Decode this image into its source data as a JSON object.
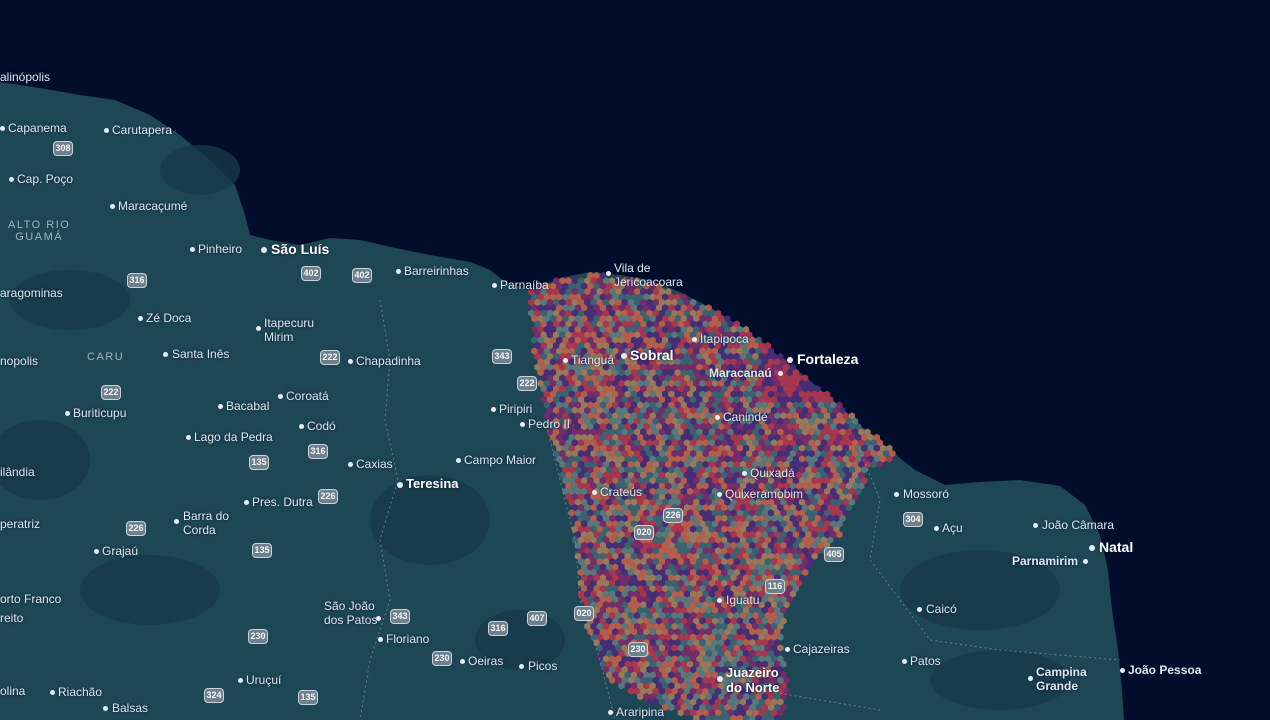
{
  "map": {
    "colors": {
      "ocean": "#020d2b",
      "land": "#1e4756",
      "land_dark": "#173a48",
      "hex_palette": [
        "#4a2a7a",
        "#7d2a6a",
        "#b8344f",
        "#c5604a",
        "#a77e5c",
        "#5f7d80",
        "#3d6675"
      ]
    },
    "places": [
      {
        "name": "alinópolis",
        "size": "small"
      },
      {
        "name": "Capanema",
        "size": "small"
      },
      {
        "name": "Carutapera",
        "size": "small"
      },
      {
        "name": "Cap. Poço",
        "size": "small"
      },
      {
        "name": "Maracaçumé",
        "size": "small"
      },
      {
        "name": "Pinheiro",
        "size": "small"
      },
      {
        "name": "São Luís",
        "size": "major"
      },
      {
        "name": "Barreirinhas",
        "size": "small"
      },
      {
        "name": "Parnaíba",
        "size": "small"
      },
      {
        "name": "Vila de\nJericoacoara",
        "size": "small"
      },
      {
        "name": "aragominas",
        "size": "small"
      },
      {
        "name": "Zé Doca",
        "size": "small"
      },
      {
        "name": "Itapecuru\nMirim",
        "size": "small"
      },
      {
        "name": "Tianguá",
        "size": "small"
      },
      {
        "name": "Sobral",
        "size": "major"
      },
      {
        "name": "Itapipoca",
        "size": "small"
      },
      {
        "name": "Fortaleza",
        "size": "major"
      },
      {
        "name": "nopolis",
        "size": "small"
      },
      {
        "name": "Santa Inês",
        "size": "small"
      },
      {
        "name": "Chapadinha",
        "size": "small"
      },
      {
        "name": "Maracanaú",
        "size": "medium"
      },
      {
        "name": "Coroatá",
        "size": "small"
      },
      {
        "name": "Bacabal",
        "size": "small"
      },
      {
        "name": "Buriticupu",
        "size": "small"
      },
      {
        "name": "Piripiri",
        "size": "small"
      },
      {
        "name": "Pedro II",
        "size": "small"
      },
      {
        "name": "Canindé",
        "size": "small"
      },
      {
        "name": "Codó",
        "size": "small"
      },
      {
        "name": "Lago da Pedra",
        "size": "small"
      },
      {
        "name": "Caxias",
        "size": "small"
      },
      {
        "name": "Campo Maior",
        "size": "small"
      },
      {
        "name": "ilândia",
        "size": "small"
      },
      {
        "name": "Quixadá",
        "size": "small"
      },
      {
        "name": "Teresina",
        "size": "major"
      },
      {
        "name": "Crateús",
        "size": "small"
      },
      {
        "name": "Quixeramobim",
        "size": "small"
      },
      {
        "name": "Mossoró",
        "size": "small"
      },
      {
        "name": "Pres. Dutra",
        "size": "small"
      },
      {
        "name": "peratriz",
        "size": "small"
      },
      {
        "name": "Barra do\nCorda",
        "size": "small"
      },
      {
        "name": "Açu",
        "size": "small"
      },
      {
        "name": "João Câmara",
        "size": "small"
      },
      {
        "name": "Natal",
        "size": "major"
      },
      {
        "name": "Grajaú",
        "size": "small"
      },
      {
        "name": "Parnamirim",
        "size": "medium"
      },
      {
        "name": "orto Franco",
        "size": "small"
      },
      {
        "name": "São João\ndos Patos",
        "size": "small"
      },
      {
        "name": "Iguatu",
        "size": "small"
      },
      {
        "name": "reito",
        "size": "small"
      },
      {
        "name": "Caicó",
        "size": "small"
      },
      {
        "name": "Floriano",
        "size": "small"
      },
      {
        "name": "Cajazeiras",
        "size": "small"
      },
      {
        "name": "Oeiras",
        "size": "small"
      },
      {
        "name": "Picos",
        "size": "small"
      },
      {
        "name": "Patos",
        "size": "small"
      },
      {
        "name": "Juazeiro\ndo Norte",
        "size": "major"
      },
      {
        "name": "Campina\nGrande",
        "size": "medium"
      },
      {
        "name": "João Pessoa",
        "size": "medium"
      },
      {
        "name": "Uruçuí",
        "size": "small"
      },
      {
        "name": "olina",
        "size": "small"
      },
      {
        "name": "Riachão",
        "size": "small"
      },
      {
        "name": "Balsas",
        "size": "small"
      },
      {
        "name": "Araripina",
        "size": "small"
      }
    ],
    "regions": [
      {
        "name": "ALTO RIO\nGUAMÁ"
      },
      {
        "name": "CARU"
      }
    ],
    "shields": [
      "308",
      "402",
      "402",
      "316",
      "343",
      "222",
      "222",
      "222",
      "135",
      "316",
      "226",
      "226",
      "020",
      "226",
      "304",
      "405",
      "116",
      "135",
      "343",
      "407",
      "020",
      "316",
      "230",
      "230",
      "230",
      "324",
      "135"
    ]
  }
}
